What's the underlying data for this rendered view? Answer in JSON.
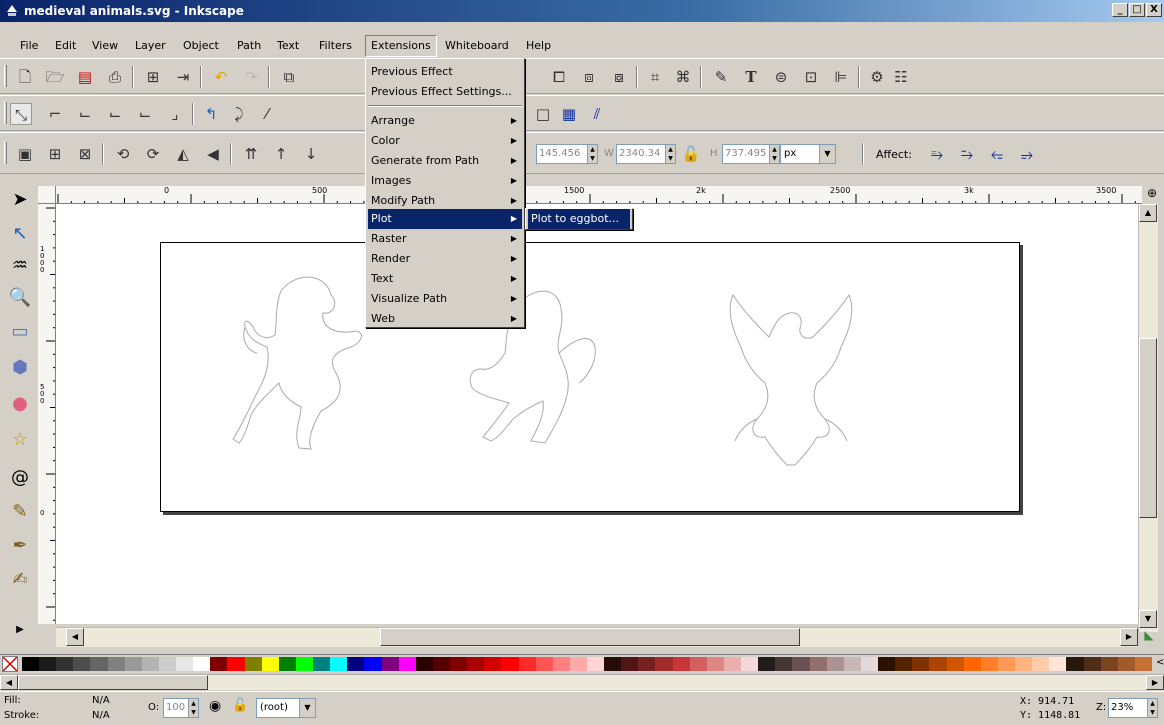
{
  "window": {
    "title": "medieval animals.svg - Inkscape",
    "minimize": "_",
    "maximize": "□",
    "close": "X"
  },
  "menubar": [
    "File",
    "Edit",
    "View",
    "Layer",
    "Object",
    "Path",
    "Text",
    "Filters",
    "Extensions",
    "Whiteboard",
    "Help"
  ],
  "extensions_menu": {
    "top_items": [
      "Previous Effect",
      "Previous Effect Settings..."
    ],
    "submenus": [
      "Arrange",
      "Color",
      "Generate from Path",
      "Images",
      "Modify Path",
      "Plot",
      "Raster",
      "Render",
      "Text",
      "Visualize Path",
      "Web"
    ],
    "highlighted": "Plot"
  },
  "plot_submenu": {
    "items": [
      "Plot to eggbot..."
    ]
  },
  "toolcontrols": {
    "y_value": "145.456",
    "w_label": "W",
    "w_value": "2340.34",
    "h_label": "H",
    "h_value": "737.495",
    "unit": "px",
    "affect_label": "Affect:"
  },
  "ruler_ticks": [
    "0",
    "500",
    "1500",
    "2k",
    "2500",
    "3k",
    "3500"
  ],
  "vruler_ticks": [
    "1000",
    "500",
    "0"
  ],
  "statusbar": {
    "fill_label": "Fill:",
    "fill_value": "N/A",
    "stroke_label": "Stroke:",
    "stroke_value": "N/A",
    "opacity_label": "O:",
    "opacity_value": "100",
    "layer": "(root)",
    "x_coord": "X:  914.71",
    "y_coord": "Y: 1148.81",
    "zoom_label": "Z:",
    "zoom_value": "23%"
  },
  "palette_colors": [
    "#000000",
    "#1a1a1a",
    "#333333",
    "#4d4d4d",
    "#666666",
    "#808080",
    "#999999",
    "#b3b3b3",
    "#cccccc",
    "#e6e6e6",
    "#ffffff",
    "#800000",
    "#ff0000",
    "#808000",
    "#ffff00",
    "#008000",
    "#00ff00",
    "#008080",
    "#00ffff",
    "#000080",
    "#0000ff",
    "#800080",
    "#ff00ff",
    "#2b0000",
    "#550000",
    "#800000",
    "#aa0000",
    "#d40000",
    "#ff0000",
    "#ff2a2a",
    "#ff5555",
    "#ff8080",
    "#ffaaaa",
    "#ffd5d5",
    "#280b0b",
    "#501616",
    "#782121",
    "#a02c2c",
    "#c83737",
    "#d35f5f",
    "#de8787",
    "#e9afaf",
    "#f4d7d7",
    "#241c1c",
    "#483737",
    "#6c5353",
    "#916f6f",
    "#ac9393",
    "#c8b7b7",
    "#e3dbdb",
    "#2b1100",
    "#552200",
    "#803300",
    "#aa4400",
    "#d45500",
    "#ff6600",
    "#ff7f2a",
    "#ff9955",
    "#ffb380",
    "#ffccaa",
    "#ffe6d5",
    "#28170b",
    "#502d16",
    "#784421",
    "#a05a2c",
    "#c87137"
  ],
  "icons": {
    "toolbox": [
      "selector-arrow-icon",
      "node-edit-icon",
      "tweak-icon",
      "zoom-icon",
      "rectangle-icon",
      "box3d-icon",
      "circle-icon",
      "star-icon",
      "spiral-icon",
      "pencil-icon",
      "pen-icon",
      "calligraphy-icon"
    ]
  }
}
